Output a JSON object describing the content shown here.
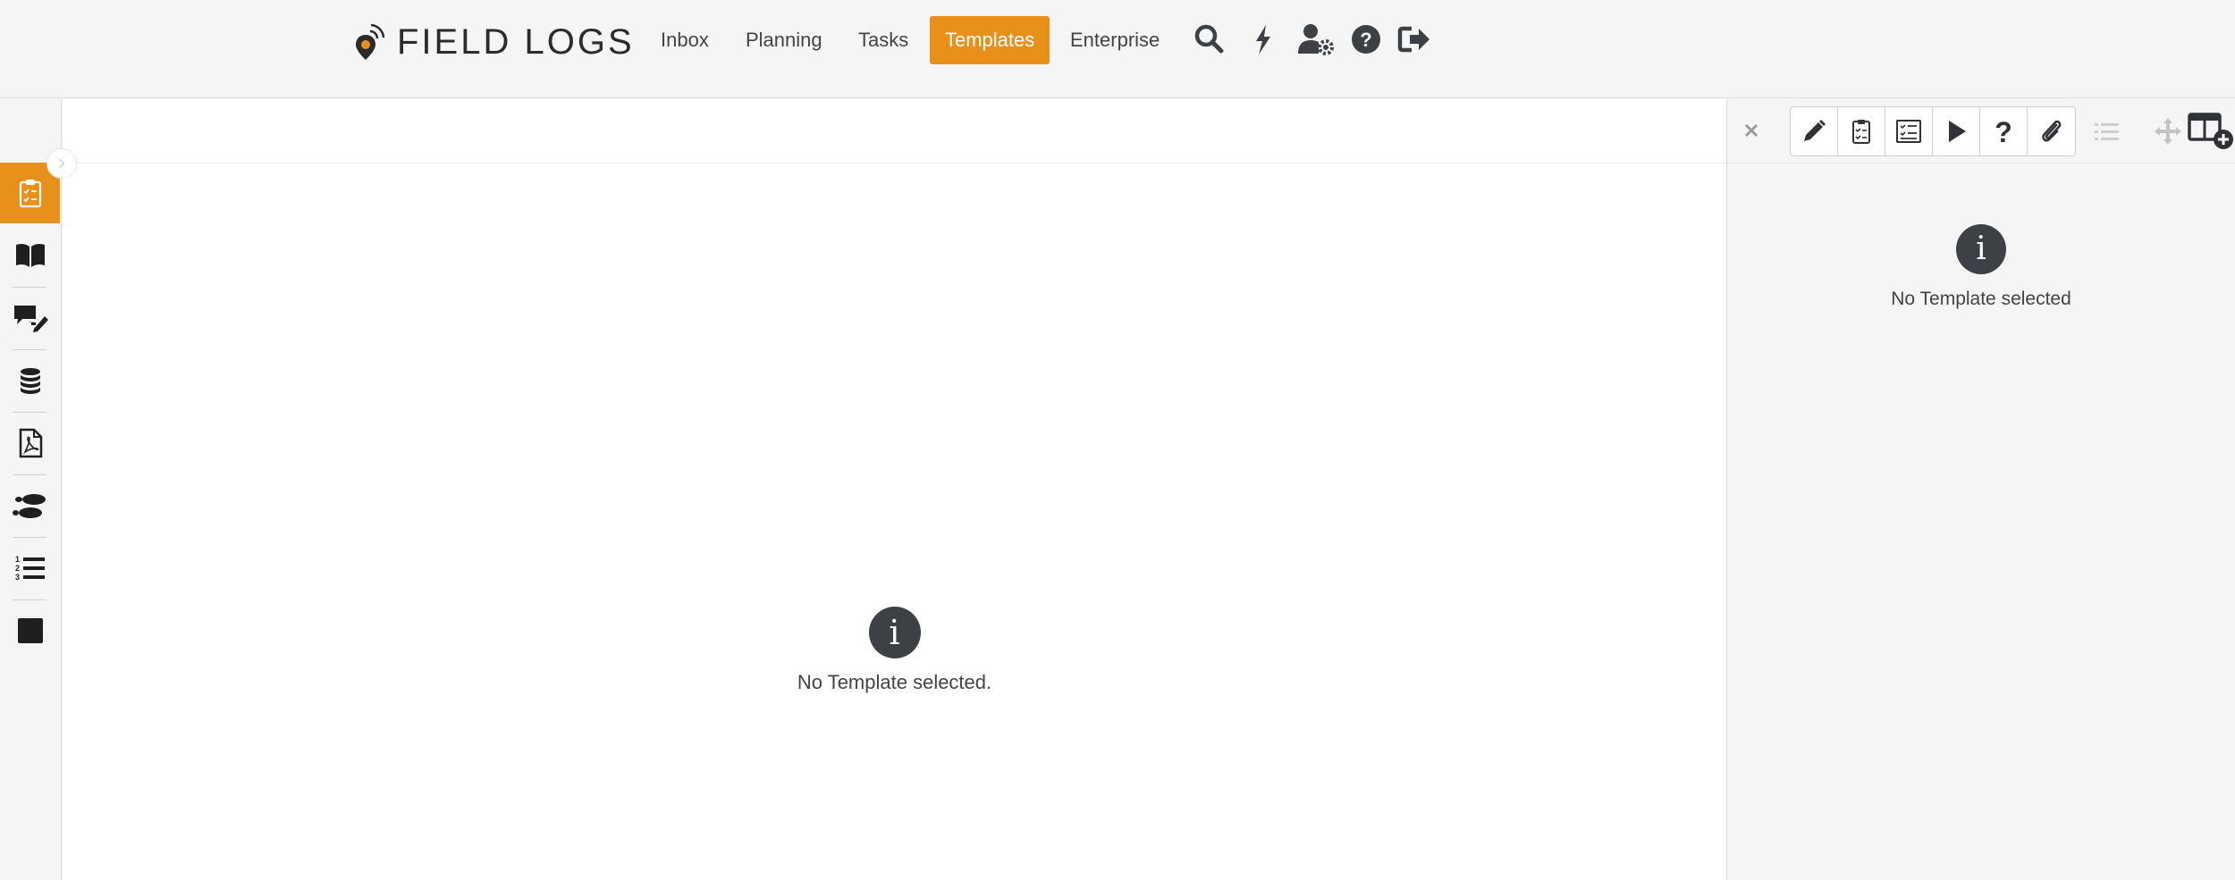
{
  "app": {
    "logo_text": "FIELD LOGS"
  },
  "nav": {
    "items": [
      {
        "label": "Inbox",
        "active": false
      },
      {
        "label": "Planning",
        "active": false
      },
      {
        "label": "Tasks",
        "active": false
      },
      {
        "label": "Templates",
        "active": true
      },
      {
        "label": "Enterprise",
        "active": false
      }
    ],
    "icons": [
      "search-icon",
      "bolt-icon",
      "user-settings-icon",
      "help-icon",
      "logout-icon"
    ]
  },
  "sidebar": {
    "items": [
      {
        "icon": "clipboard-check-icon",
        "active": true
      },
      {
        "icon": "book-icon",
        "active": false
      },
      {
        "icon": "comments-edit-icon",
        "active": false
      },
      {
        "icon": "database-icon",
        "active": false
      },
      {
        "icon": "pdf-file-icon",
        "active": false
      },
      {
        "icon": "footprints-icon",
        "active": false
      },
      {
        "icon": "numbered-list-icon",
        "active": false
      },
      {
        "icon": "square-icon",
        "active": false
      }
    ]
  },
  "main": {
    "empty_message": "No Template selected."
  },
  "right_panel": {
    "tools": [
      "pencil-icon",
      "clipboard-icon",
      "checklist-icon",
      "play-icon",
      "question-icon",
      "paperclip-icon"
    ],
    "extra_icons": [
      "list-icon",
      "move-icon",
      "add-column-icon"
    ],
    "empty_message": "No Template selected"
  },
  "colors": {
    "accent": "#e8901a",
    "icon_dark": "#3d4045",
    "muted": "#c8c8c8"
  }
}
